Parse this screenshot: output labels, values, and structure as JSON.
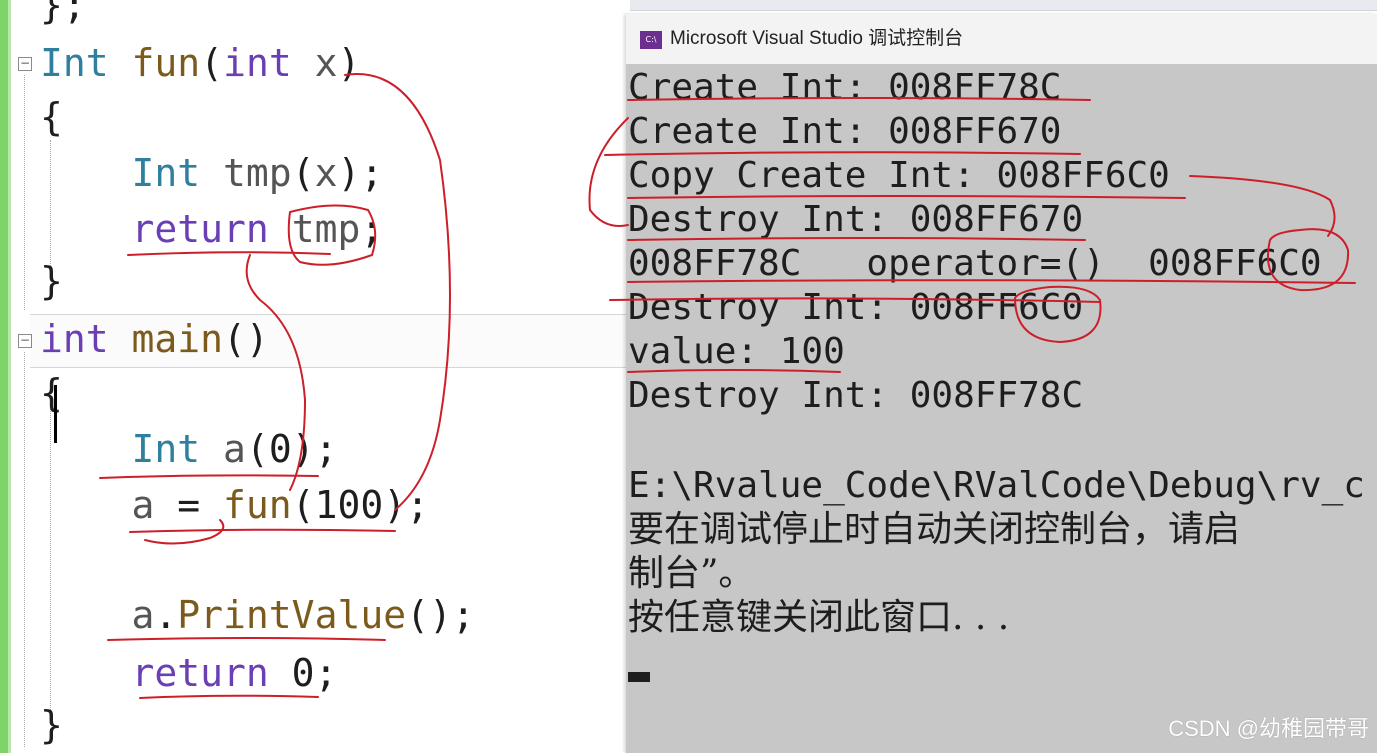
{
  "editor": {
    "lines": [
      {
        "id": "line-brace-top",
        "tokens": [
          {
            "c": "n",
            "s": "};"
          }
        ]
      },
      {
        "id": "line-fun-sig",
        "tokens": [
          {
            "c": "t",
            "s": "Int"
          },
          {
            "c": "n",
            "s": " "
          },
          {
            "c": "f",
            "s": "fun"
          },
          {
            "c": "n",
            "s": "("
          },
          {
            "c": "k",
            "s": "int"
          },
          {
            "c": "n",
            "s": " "
          },
          {
            "c": "v",
            "s": "x"
          },
          {
            "c": "n",
            "s": ")"
          }
        ]
      },
      {
        "id": "line-fun-open",
        "tokens": [
          {
            "c": "n",
            "s": "{"
          }
        ]
      },
      {
        "id": "line-tmp-decl",
        "tokens": [
          {
            "c": "n",
            "s": "    "
          },
          {
            "c": "t",
            "s": "Int"
          },
          {
            "c": "n",
            "s": " "
          },
          {
            "c": "v",
            "s": "tmp"
          },
          {
            "c": "n",
            "s": "("
          },
          {
            "c": "v",
            "s": "x"
          },
          {
            "c": "n",
            "s": ");"
          }
        ]
      },
      {
        "id": "line-return-tmp",
        "tokens": [
          {
            "c": "n",
            "s": "    "
          },
          {
            "c": "k",
            "s": "return"
          },
          {
            "c": "n",
            "s": " "
          },
          {
            "c": "v",
            "s": "tmp"
          },
          {
            "c": "n",
            "s": ";"
          }
        ]
      },
      {
        "id": "line-fun-close",
        "tokens": [
          {
            "c": "n",
            "s": "}"
          }
        ]
      },
      {
        "id": "line-main-sig",
        "tokens": [
          {
            "c": "k",
            "s": "int"
          },
          {
            "c": "n",
            "s": " "
          },
          {
            "c": "f",
            "s": "main"
          },
          {
            "c": "n",
            "s": "()"
          }
        ]
      },
      {
        "id": "line-main-open",
        "tokens": [
          {
            "c": "n",
            "s": "{"
          }
        ]
      },
      {
        "id": "line-a-decl",
        "tokens": [
          {
            "c": "n",
            "s": "    "
          },
          {
            "c": "t",
            "s": "Int"
          },
          {
            "c": "n",
            "s": " "
          },
          {
            "c": "v",
            "s": "a"
          },
          {
            "c": "n",
            "s": "(0);"
          }
        ]
      },
      {
        "id": "line-a-assign",
        "tokens": [
          {
            "c": "n",
            "s": "    "
          },
          {
            "c": "v",
            "s": "a"
          },
          {
            "c": "n",
            "s": " = "
          },
          {
            "c": "f",
            "s": "fun"
          },
          {
            "c": "n",
            "s": "(100);"
          }
        ]
      },
      {
        "id": "line-print",
        "tokens": [
          {
            "c": "n",
            "s": "    "
          },
          {
            "c": "v",
            "s": "a"
          },
          {
            "c": "n",
            "s": "."
          },
          {
            "c": "f",
            "s": "PrintValue"
          },
          {
            "c": "n",
            "s": "();"
          }
        ]
      },
      {
        "id": "line-return-0",
        "tokens": [
          {
            "c": "n",
            "s": "    "
          },
          {
            "c": "k",
            "s": "return"
          },
          {
            "c": "n",
            "s": " 0;"
          }
        ]
      },
      {
        "id": "line-main-close",
        "tokens": [
          {
            "c": "n",
            "s": "}"
          }
        ]
      }
    ]
  },
  "console": {
    "title": "Microsoft Visual Studio 调试控制台",
    "icon_name": "console-app-icon",
    "output": [
      "Create Int: 008FF78C",
      "Create Int: 008FF670",
      "Copy Create Int: 008FF6C0",
      "Destroy Int: 008FF670",
      "008FF78C   operator=()  008FF6C0",
      "Destroy Int: 008FF6C0",
      "value: 100",
      "Destroy Int: 008FF78C",
      "",
      "E:\\Rvalue_Code\\RValCode\\Debug\\rv_c",
      "要在调试停止时自动关闭控制台，请启",
      "制台”。",
      "按任意键关闭此窗口. . ."
    ]
  },
  "watermark": "CSDN @幼稚园带哥",
  "colors": {
    "keyword": "#6b3fb3",
    "type": "#2f7f9f",
    "function": "#7c5a1c",
    "annotation": "#cc1f2a",
    "console_bg": "#c7c7c7",
    "change_bar": "#7fd36b"
  }
}
